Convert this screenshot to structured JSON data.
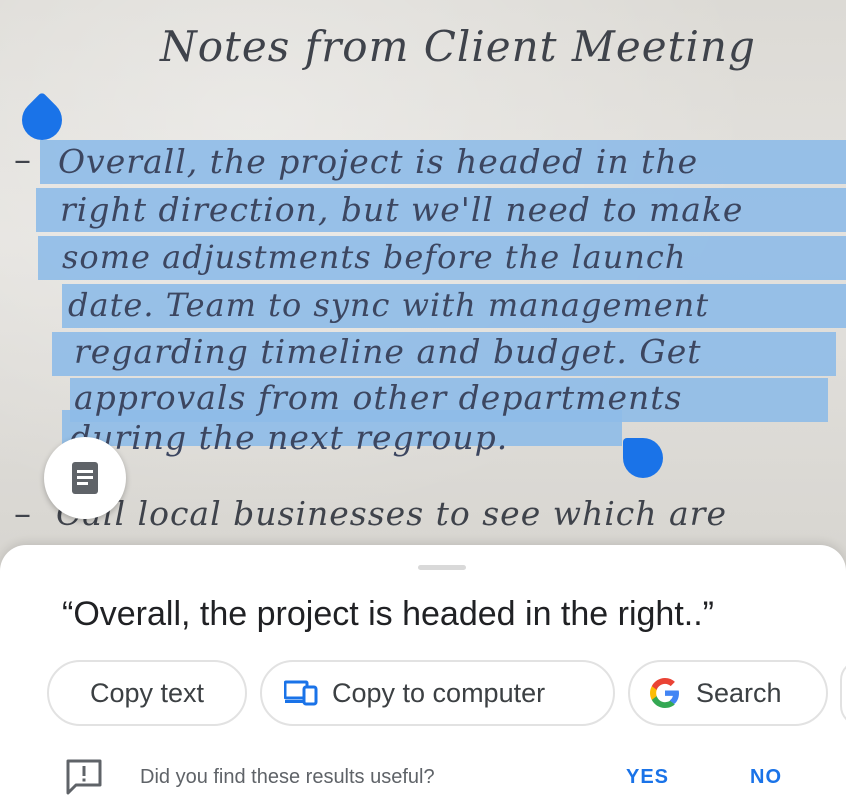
{
  "image": {
    "title": "Notes from Client Meeting",
    "lines": [
      "Overall, the project is headed in the",
      "right direction, but we'll need to make",
      "some adjustments before the launch",
      "date. Team to sync with management",
      "regarding timeline and budget. Get",
      "approvals from other departments",
      "during the next regroup.",
      "Call local businesses to see which are"
    ]
  },
  "sheet": {
    "quote": "“Overall, the project is headed in the right..”",
    "chips": {
      "copy_text": "Copy text",
      "copy_to_computer": "Copy to computer",
      "search": "Search"
    },
    "feedback": {
      "question": "Did you find these results useful?",
      "yes": "YES",
      "no": "NO"
    }
  },
  "colors": {
    "accent": "#1a73e8",
    "highlight": "#8ebbe8"
  }
}
